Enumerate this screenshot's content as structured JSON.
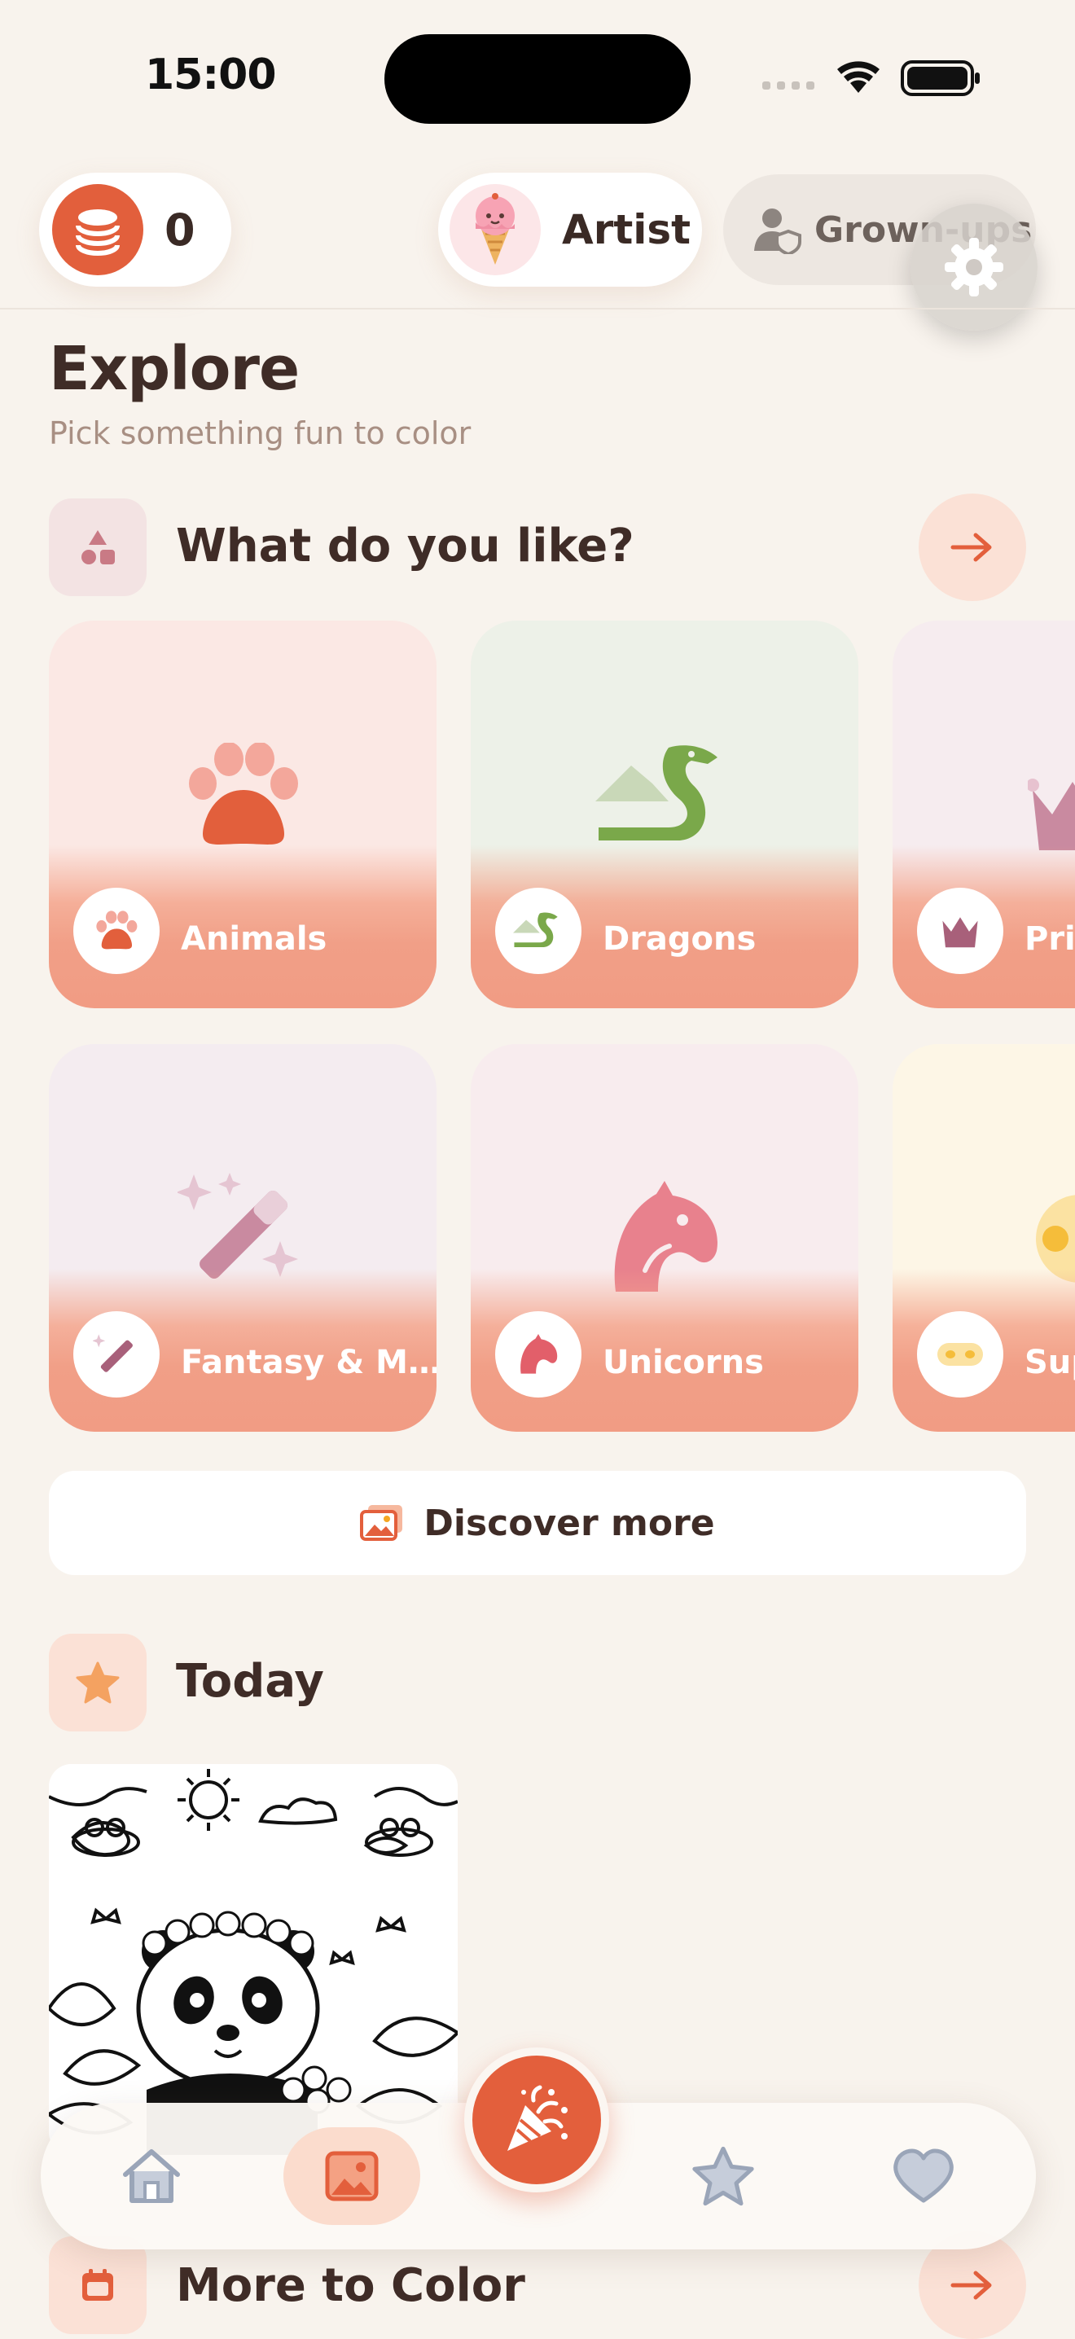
{
  "status_bar": {
    "time": "15:00"
  },
  "top_bar": {
    "coins": "0",
    "profile_name": "Artist",
    "grownups_label": "Grown-ups"
  },
  "header": {
    "title": "Explore",
    "subtitle": "Pick something fun to color"
  },
  "likes_section": {
    "title": "What do you like?"
  },
  "categories": [
    {
      "label": "Animals",
      "icon": "paw-icon",
      "bg": "#fbe8e4"
    },
    {
      "label": "Dragons",
      "icon": "dragon-icon",
      "bg": "#edf1e8"
    },
    {
      "label": "Pri",
      "icon": "crown-icon",
      "bg": "#f6ecef"
    },
    {
      "label": "Fantasy & M…",
      "icon": "magic-wand-icon",
      "bg": "#f4ecf0"
    },
    {
      "label": "Unicorns",
      "icon": "unicorn-icon",
      "bg": "#f8ecee"
    },
    {
      "label": "Sup",
      "icon": "mask-icon",
      "bg": "#fdf6e6"
    }
  ],
  "discover": {
    "label": "Discover more"
  },
  "today": {
    "title": "Today"
  },
  "more_section": {
    "title": "More to Color"
  },
  "nav": {
    "items": [
      "home-icon",
      "gallery-icon",
      "party-popper-icon",
      "star-icon",
      "heart-icon"
    ],
    "active": "gallery-icon"
  },
  "colors": {
    "accent": "#e35f3c",
    "background": "#f8f3ed"
  }
}
